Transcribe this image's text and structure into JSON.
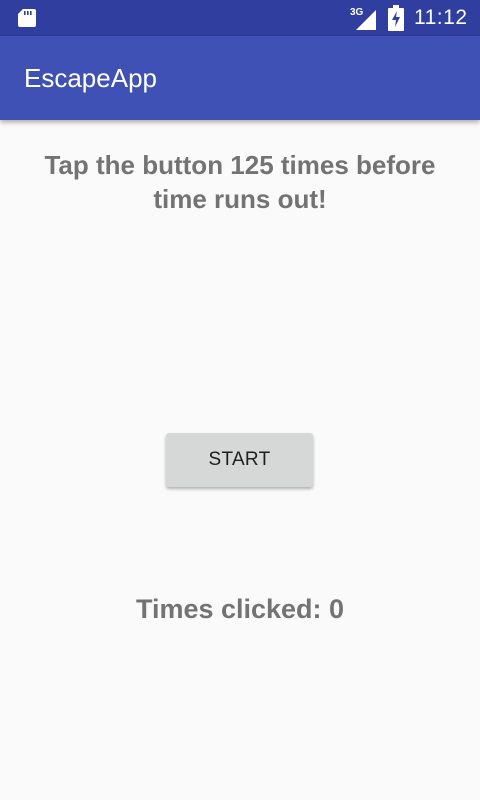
{
  "status_bar": {
    "icons": [
      "sd-card-icon",
      "signal-3g-icon",
      "battery-charging-icon"
    ],
    "network_label": "3G",
    "time": "11:12",
    "background": "#303f9f"
  },
  "app_bar": {
    "title": "EscapeApp",
    "background": "#3f51b5"
  },
  "main": {
    "instruction": "Tap the button 125 times before time runs out!",
    "start_button_label": "START",
    "counter_text": "Times clicked: 0"
  },
  "colors": {
    "background": "#fafafa",
    "text_gray": "#737373",
    "button_gray": "#d6d7d7"
  }
}
